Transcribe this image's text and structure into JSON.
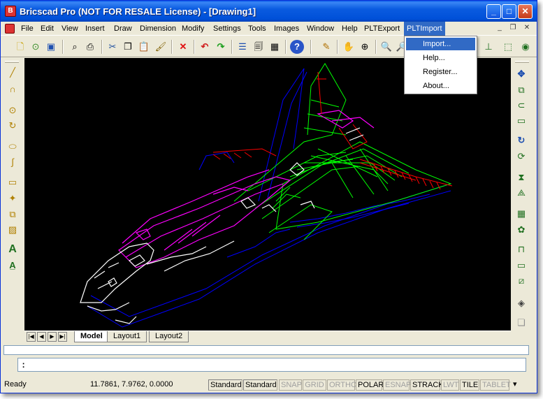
{
  "window": {
    "title": "Bricscad Pro (NOT FOR RESALE License) - [Drawing1]",
    "minimize_glyph": "_",
    "maximize_glyph": "□",
    "close_glyph": "✕"
  },
  "menubar": {
    "items": [
      {
        "label": "File"
      },
      {
        "label": "Edit"
      },
      {
        "label": "View"
      },
      {
        "label": "Insert"
      },
      {
        "label": "Draw"
      },
      {
        "label": "Dimension"
      },
      {
        "label": "Modify"
      },
      {
        "label": "Settings"
      },
      {
        "label": "Tools"
      },
      {
        "label": "Images"
      },
      {
        "label": "Window"
      },
      {
        "label": "Help"
      },
      {
        "label": "PLTExport"
      },
      {
        "label": "PLTImport",
        "active": true
      }
    ],
    "mdi_min": "_",
    "mdi_restore": "❐",
    "mdi_close": "✕"
  },
  "dropdown": {
    "items": [
      {
        "label": "Import...",
        "hover": true
      },
      {
        "label": "Help..."
      },
      {
        "label": "Register..."
      },
      {
        "label": "About..."
      }
    ]
  },
  "toolbar": {
    "icons": [
      "new-file-icon",
      "open-folder-icon",
      "save-icon",
      "print-preview-icon",
      "print-icon",
      "cut-icon",
      "copy-icon",
      "paste-icon",
      "match-properties-icon",
      "delete-icon",
      "undo-icon",
      "redo-icon",
      "properties-icon",
      "explorer-icon",
      "design-center-icon",
      "help-icon",
      "pencil-icon",
      "pan-icon",
      "zoom-realtime-icon",
      "zoom-in-icon",
      "zoom-out-icon"
    ],
    "right_icons": [
      "ucs-icon",
      "3d-box-icon",
      "render-icon"
    ]
  },
  "left_tools": [
    "line-icon",
    "polyline-icon",
    "circle-icon",
    "arc-icon",
    "ellipse-icon",
    "spline-icon",
    "rectangle-icon",
    "point-icon",
    "block-icon",
    "hatch-icon",
    "text-icon",
    "mtext-icon"
  ],
  "right_tools": [
    "move-icon",
    "copy-entity-icon",
    "offset-icon",
    "stretch-icon",
    "rotate-icon",
    "rotate3d-icon",
    "mirror-icon",
    "mirror3d-icon",
    "array-icon",
    "array-polar-icon",
    "trim-icon",
    "extend-icon",
    "break-icon",
    "box-3d-icon",
    "explode-icon"
  ],
  "layout_tabs": [
    {
      "label": "Model",
      "active": true
    },
    {
      "label": "Layout1"
    },
    {
      "label": "Layout2"
    }
  ],
  "command": {
    "prompt": ":"
  },
  "status": {
    "ready": "Ready",
    "coords": "11.7861, 7.9762, 0.0000",
    "std1": "Standard",
    "std2": "Standard",
    "toggles": [
      {
        "label": "SNAP",
        "on": false
      },
      {
        "label": "GRID",
        "on": false
      },
      {
        "label": "ORTHO",
        "on": false
      },
      {
        "label": "POLAR",
        "on": true
      },
      {
        "label": "ESNAP",
        "on": false
      },
      {
        "label": "STRACK",
        "on": true
      },
      {
        "label": "LWT",
        "on": false
      },
      {
        "label": "TILE",
        "on": true
      },
      {
        "label": "TABLET",
        "on": false
      }
    ],
    "arrow": "▾"
  },
  "colors": {
    "wire_white": "#ffffff",
    "wire_magenta": "#ff00ff",
    "wire_green": "#00ff00",
    "wire_blue": "#0000ff",
    "wire_red": "#ff0000"
  }
}
